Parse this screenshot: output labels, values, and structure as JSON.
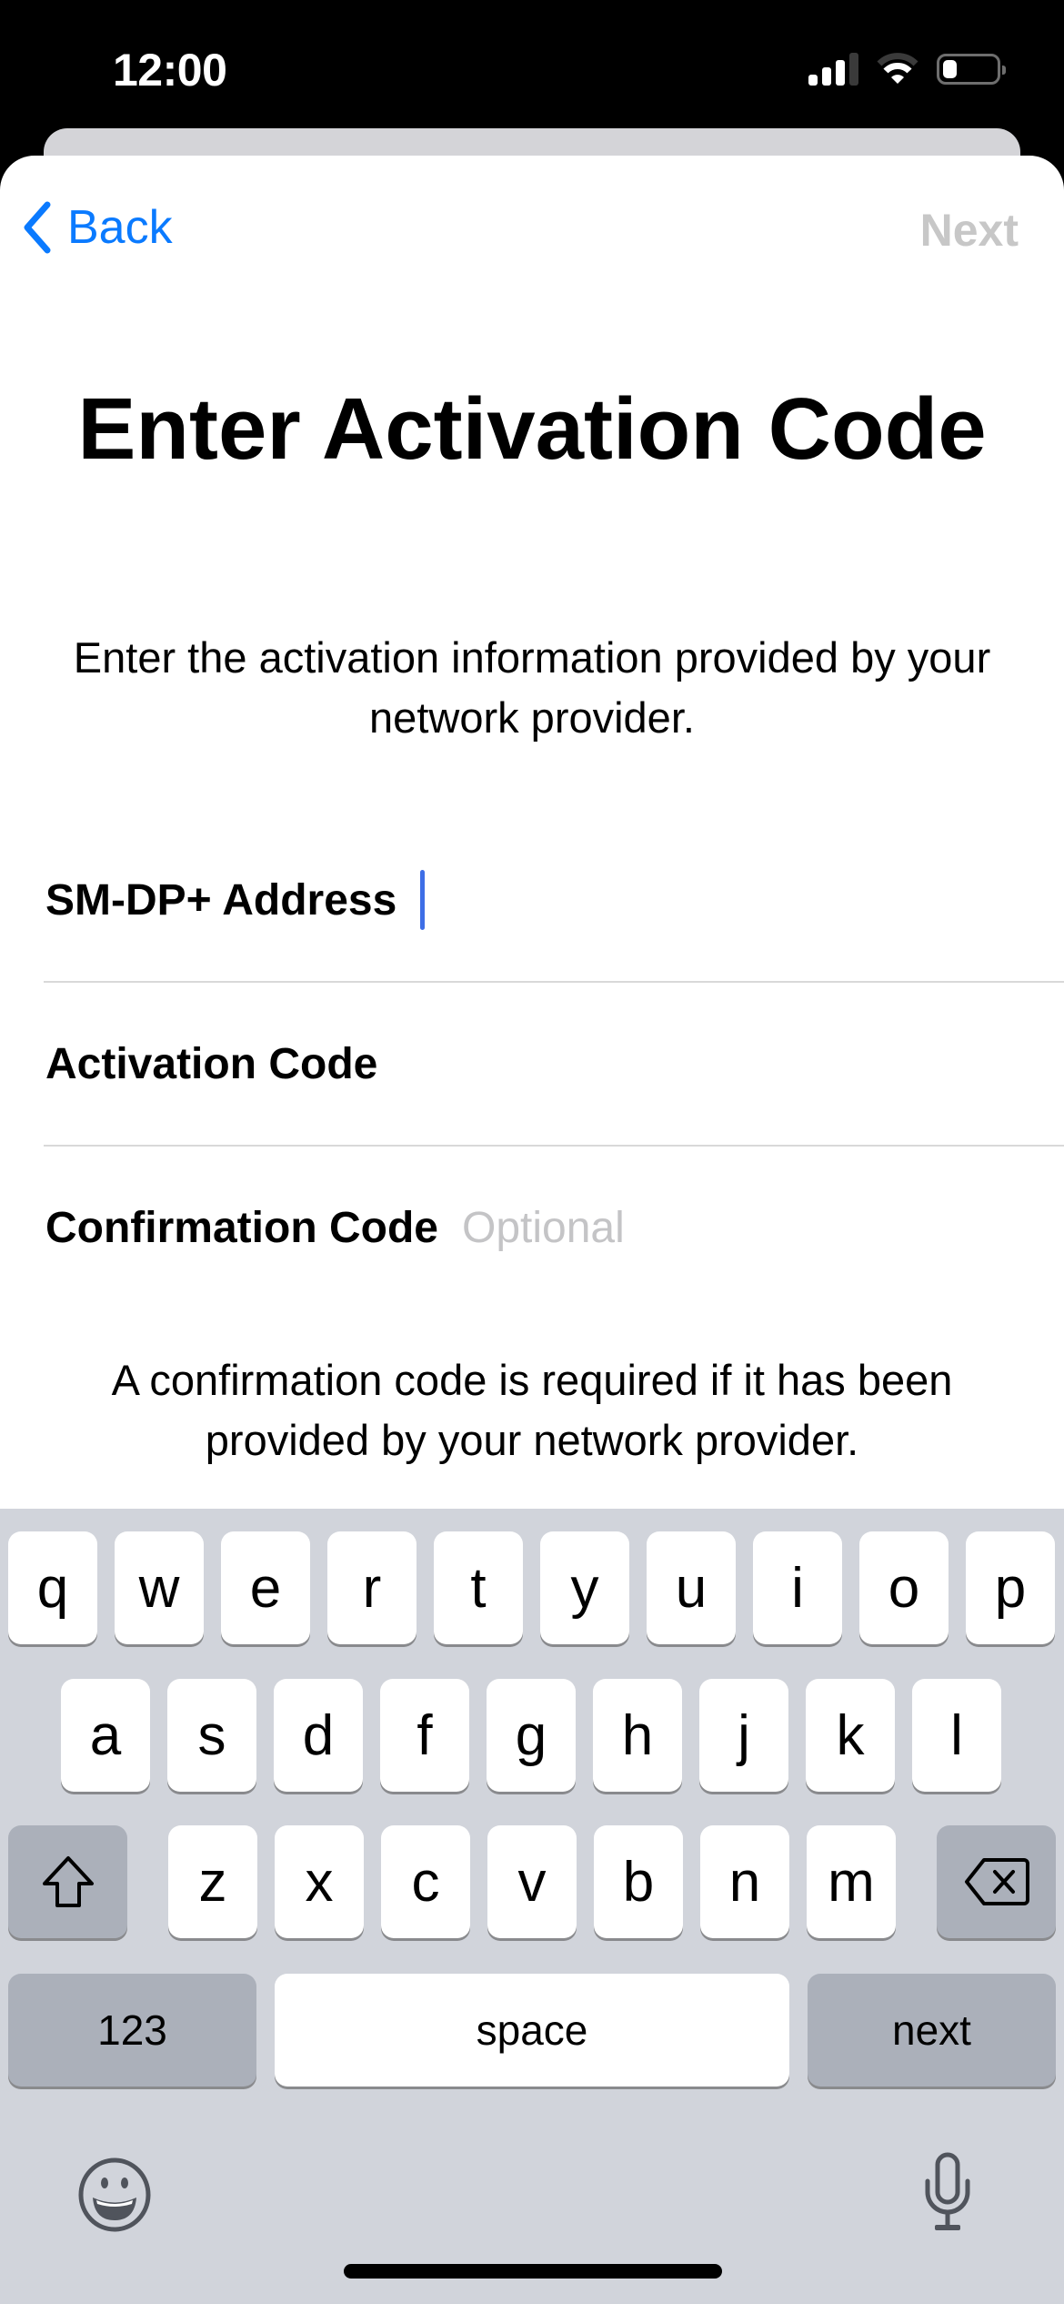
{
  "status_bar": {
    "time": "12:00",
    "signal_bars_active": 3,
    "signal_bars_total": 4,
    "wifi_arcs_active": 2,
    "wifi_arcs_total": 3,
    "battery_level": 0.25
  },
  "nav": {
    "back_label": "Back",
    "next_label": "Next",
    "next_enabled": false
  },
  "page": {
    "title": "Enter Activation Code",
    "subtitle": "Enter the activation information provided by your network provider."
  },
  "form": {
    "fields": [
      {
        "label": "SM-DP+ Address",
        "value": "",
        "placeholder": "",
        "focused": true
      },
      {
        "label": "Activation Code",
        "value": "",
        "placeholder": ""
      },
      {
        "label": "Confirmation Code",
        "value": "",
        "placeholder": "Optional"
      }
    ],
    "note": "A confirmation code is required if it has been provided by your network provider."
  },
  "keyboard": {
    "row1": [
      "q",
      "w",
      "e",
      "r",
      "t",
      "y",
      "u",
      "i",
      "o",
      "p"
    ],
    "row2": [
      "a",
      "s",
      "d",
      "f",
      "g",
      "h",
      "j",
      "k",
      "l"
    ],
    "row3": [
      "z",
      "x",
      "c",
      "v",
      "b",
      "n",
      "m"
    ],
    "shift_icon": "shift-arrow-icon",
    "delete_icon": "backspace-icon",
    "numbers_label": "123",
    "space_label": "space",
    "return_label": "next",
    "emoji_icon": "emoji-icon",
    "dictation_icon": "microphone-icon"
  },
  "colors": {
    "accent": "#0a7aff",
    "disabled": "#c7c7c7",
    "caret": "#3e6ee6",
    "keyboard_bg": "#d1d4db",
    "modifier_key": "#abb0ba"
  }
}
